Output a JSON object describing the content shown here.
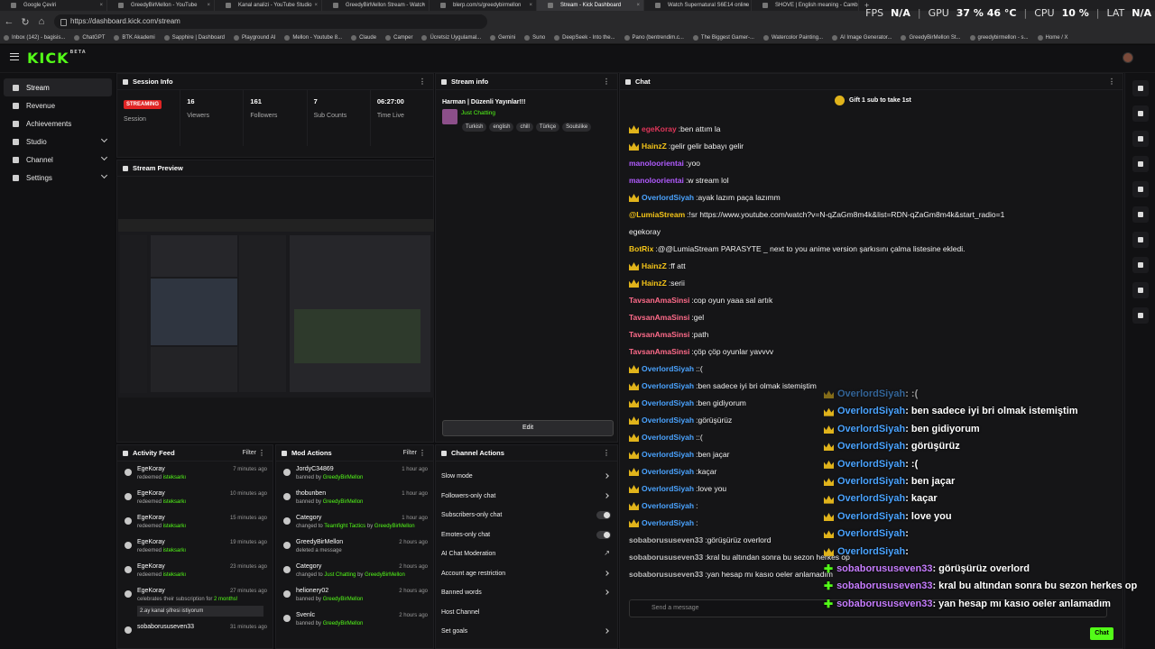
{
  "browser": {
    "tabs": [
      {
        "label": "Google Çeviri",
        "active": false
      },
      {
        "label": "GreedyBirMellon - YouTube",
        "active": false
      },
      {
        "label": "Kanal analizi - YouTube Studio",
        "active": false
      },
      {
        "label": "GreedyBirMellon Stream - Watch",
        "active": false
      },
      {
        "label": "blerp.com/s/greedybirmellon",
        "active": false
      },
      {
        "label": "Stream - Kick Dashboard",
        "active": true
      },
      {
        "label": "Watch Supernatural S6E14 online",
        "active": false
      },
      {
        "label": "SHOVE | English meaning - Camb",
        "active": false
      }
    ],
    "new_tab": "+",
    "url": "https://dashboard.kick.com/stream",
    "bookmarks": [
      "Inbox (142) - bagisis...",
      "ChatGPT",
      "BTK Akademi",
      "Sapphire | Dashboard",
      "Playground AI",
      "Mellon - Youtube 8...",
      "Claude",
      "Camper",
      "Ücretsiz Uygulamal...",
      "Gemini",
      "Suno",
      "DeepSeek - Into the...",
      "Pano (bentrendim.c...",
      "The Biggest Gamer-...",
      "Watercolor Painting...",
      "AI Image Generator...",
      "GreedyBirMellon St...",
      "greedybirmellon - s...",
      "Home / X"
    ]
  },
  "hud": {
    "fps_label": "FPS",
    "fps": "N/A",
    "gpu_label": "GPU",
    "gpu": "37 % 46 °C",
    "cpu_label": "CPU",
    "cpu": "10 %",
    "lat_label": "LAT",
    "lat": "N/A"
  },
  "app": {
    "logo": "KICK",
    "logo_sup": "BETA"
  },
  "sidebar": {
    "items": [
      {
        "label": "Stream",
        "active": true
      },
      {
        "label": "Revenue"
      },
      {
        "label": "Achievements"
      },
      {
        "label": "Studio",
        "chevron": true
      },
      {
        "label": "Channel",
        "chevron": true
      },
      {
        "label": "Settings",
        "chevron": true
      }
    ]
  },
  "session": {
    "title": "Session Info",
    "status_badge": "STREAMING",
    "status_label": "Session",
    "stats": [
      {
        "value": "16",
        "label": "Viewers"
      },
      {
        "value": "161",
        "label": "Followers"
      },
      {
        "value": "7",
        "label": "Sub Counts"
      },
      {
        "value": "06:27:00",
        "label": "Time Live"
      }
    ]
  },
  "preview": {
    "title": "Stream Preview"
  },
  "stream_info": {
    "title": "Stream info",
    "stream_title": "Harman | Düzenli Yayınlar!!!",
    "category": "Just Chatting",
    "tags": [
      "Turkish",
      "english",
      "chill",
      "Türkçe",
      "Soulslike"
    ],
    "edit_label": "Edit"
  },
  "activity": {
    "title": "Activity Feed",
    "filter": "Filter",
    "items": [
      {
        "name": "EgeKoray",
        "verb": "redeemed",
        "item": "isteksarkı",
        "time": "7 minutes ago"
      },
      {
        "name": "EgeKoray",
        "verb": "redeemed",
        "item": "isteksarkı",
        "time": "10 minutes ago"
      },
      {
        "name": "EgeKoray",
        "verb": "redeemed",
        "item": "isteksarkı",
        "time": "15 minutes ago"
      },
      {
        "name": "EgeKoray",
        "verb": "redeemed",
        "item": "isteksarkı",
        "time": "19 minutes ago"
      },
      {
        "name": "EgeKoray",
        "verb": "redeemed",
        "item": "isteksarkı",
        "time": "23 minutes ago"
      },
      {
        "name": "EgeKoray",
        "verb": "celebrates their subscription for",
        "item": "2 months!",
        "time": "27 minutes ago",
        "note": "2.ay kanal şifresi istiyorum"
      },
      {
        "name": "sobaborususeven33",
        "verb": "",
        "item": "",
        "time": "31 minutes ago"
      }
    ]
  },
  "mod": {
    "title": "Mod Actions",
    "filter": "Filter",
    "items": [
      {
        "name": "JordyC34869",
        "sub": "banned by",
        "by": "GreedyBirMellon",
        "time": "1 hour ago"
      },
      {
        "name": "thobunben",
        "sub": "banned by",
        "by": "GreedyBirMellon",
        "time": "1 hour ago"
      },
      {
        "name": "Category",
        "sub": "changed to",
        "by": "Teamfight Tactics",
        "sub2": "by",
        "by2": "GreedyBirMellon",
        "time": "1 hour ago"
      },
      {
        "name": "GreedyBirMellon",
        "sub": "deleted a message",
        "by": "",
        "time": "2 hours ago"
      },
      {
        "name": "Category",
        "sub": "changed to",
        "by": "Just Chatting",
        "sub2": "by",
        "by2": "GreedyBirMellon",
        "time": "2 hours ago"
      },
      {
        "name": "helionery02",
        "sub": "banned by",
        "by": "GreedyBirMellon",
        "time": "2 hours ago"
      },
      {
        "name": "Svenlc",
        "sub": "banned by",
        "by": "GreedyBirMellon",
        "time": "2 hours ago"
      }
    ]
  },
  "channel_actions": {
    "title": "Channel Actions",
    "items": [
      {
        "label": "Slow mode",
        "kind": "arrow"
      },
      {
        "label": "Followers-only chat",
        "kind": "arrow"
      },
      {
        "label": "Subscribers-only chat",
        "kind": "toggle"
      },
      {
        "label": "Emotes-only chat",
        "kind": "toggle"
      },
      {
        "label": "AI Chat Moderation",
        "kind": "ext"
      },
      {
        "label": "Account age restriction",
        "kind": "arrow"
      },
      {
        "label": "Banned words",
        "kind": "arrow"
      },
      {
        "label": "Host Channel",
        "kind": "none"
      },
      {
        "label": "Set goals",
        "kind": "arrow"
      }
    ]
  },
  "chat": {
    "title": "Chat",
    "gift_text": "Gift 1 sub to take 1st",
    "gift_rank": "1",
    "input_placeholder": "Send a message",
    "send_label": "Chat",
    "messages": [
      {
        "user": "egeKoray",
        "color": "#e0365a",
        "text": "ben attım la",
        "crown": true
      },
      {
        "user": "HainzZ",
        "color": "#f5c518",
        "text": "gelir gelir babayı gelir",
        "crown": true
      },
      {
        "user": "manoloorientai",
        "color": "#b15bff",
        "text": "yoo",
        "crown": false
      },
      {
        "user": "manoloorientai",
        "color": "#b15bff",
        "text": "w stream lol",
        "crown": false
      },
      {
        "user": "OverlordSiyah",
        "color": "#4aa3ff",
        "text": "ayak lazım paça lazımm",
        "crown": true
      },
      {
        "user": "@LumiaStream",
        "color": "#f5c518",
        "text": "!sr https://www.youtube.com/watch?v=N-qZaGm8m4k&list=RDN-qZaGm8m4k&start_radio=1",
        "crown": false
      },
      {
        "user": "",
        "color": "#f0f0f0",
        "text": "egekoray",
        "crown": false
      },
      {
        "user": "BotRix",
        "color": "#f5c518",
        "text": "@@LumiaStream PARASYTE _ next to you anime version şarkısını çalma listesine ekledi.",
        "crown": false
      },
      {
        "user": "HainzZ",
        "color": "#f5c518",
        "text": "ff att",
        "crown": true
      },
      {
        "user": "HainzZ",
        "color": "#f5c518",
        "text": "serii",
        "crown": true
      },
      {
        "user": "TavsanAmaSinsi",
        "color": "#ff6b8a",
        "text": "cop oyun yaaa sal artık",
        "crown": false
      },
      {
        "user": "TavsanAmaSinsi",
        "color": "#ff6b8a",
        "text": "gel",
        "crown": false
      },
      {
        "user": "TavsanAmaSinsi",
        "color": "#ff6b8a",
        "text": "path",
        "crown": false
      },
      {
        "user": "TavsanAmaSinsi",
        "color": "#ff6b8a",
        "text": "çöp çöp oyunlar yavvvv",
        "crown": false
      },
      {
        "user": "OverlordSiyah",
        "color": "#4aa3ff",
        "text": ":(",
        "crown": true
      },
      {
        "user": "OverlordSiyah",
        "color": "#4aa3ff",
        "text": "ben sadece iyi bri olmak istemiştim",
        "crown": true
      },
      {
        "user": "OverlordSiyah",
        "color": "#4aa3ff",
        "text": "ben gidiyorum",
        "crown": true
      },
      {
        "user": "OverlordSiyah",
        "color": "#4aa3ff",
        "text": "görüşürüz",
        "crown": true
      },
      {
        "user": "OverlordSiyah",
        "color": "#4aa3ff",
        "text": ":(",
        "crown": true
      },
      {
        "user": "OverlordSiyah",
        "color": "#4aa3ff",
        "text": "ben jaçar",
        "crown": true
      },
      {
        "user": "OverlordSiyah",
        "color": "#4aa3ff",
        "text": "kaçar",
        "crown": true
      },
      {
        "user": "OverlordSiyah",
        "color": "#4aa3ff",
        "text": "love you",
        "crown": true
      },
      {
        "user": "OverlordSiyah",
        "color": "#4aa3ff",
        "text": "",
        "crown": true
      },
      {
        "user": "OverlordSiyah",
        "color": "#4aa3ff",
        "text": "",
        "crown": true
      },
      {
        "user": "sobaborususeven33",
        "color": "#bbbbbb",
        "text": "görüşürüz overlord",
        "crown": false
      },
      {
        "user": "sobaborususeven33",
        "color": "#bbbbbb",
        "text": "kral bu altından sonra bu sezon herkes op",
        "crown": false
      },
      {
        "user": "sobaborususeven33",
        "color": "#bbbbbb",
        "text": "yan hesap mı kasıo oeler anlamadım",
        "crown": false
      }
    ]
  },
  "overlay": {
    "lines": [
      {
        "user": "OverlordSiyah",
        "text": " : :(",
        "kind": "crown",
        "dim": true
      },
      {
        "user": "OverlordSiyah",
        "text": " : ben sadece iyi bri olmak istemiştim",
        "kind": "crown"
      },
      {
        "user": "OverlordSiyah",
        "text": " : ben gidiyorum",
        "kind": "crown"
      },
      {
        "user": "OverlordSiyah",
        "text": " : görüşürüz",
        "kind": "crown"
      },
      {
        "user": "OverlordSiyah",
        "text": " : :(",
        "kind": "crown"
      },
      {
        "user": "OverlordSiyah",
        "text": " : ben jaçar",
        "kind": "crown"
      },
      {
        "user": "OverlordSiyah",
        "text": " : kaçar",
        "kind": "crown"
      },
      {
        "user": "OverlordSiyah",
        "text": " : love you",
        "kind": "crown"
      },
      {
        "user": "OverlordSiyah",
        "text": " :",
        "kind": "crown"
      },
      {
        "user": "OverlordSiyah",
        "text": " :",
        "kind": "crown"
      },
      {
        "user": "sobaborususeven33",
        "text": " : görüşürüz overlord",
        "kind": "plus"
      },
      {
        "user": "sobaborususeven33",
        "text": " : kral bu altından sonra bu sezon herkes op",
        "kind": "plus"
      },
      {
        "user": "sobaborususeven33",
        "text": " : yan hesap mı kasıo oeler anlamadım",
        "kind": "plus"
      }
    ]
  },
  "colors": {
    "accent": "#53fc18",
    "live": "#e02424",
    "crown": "#e0b31b"
  }
}
